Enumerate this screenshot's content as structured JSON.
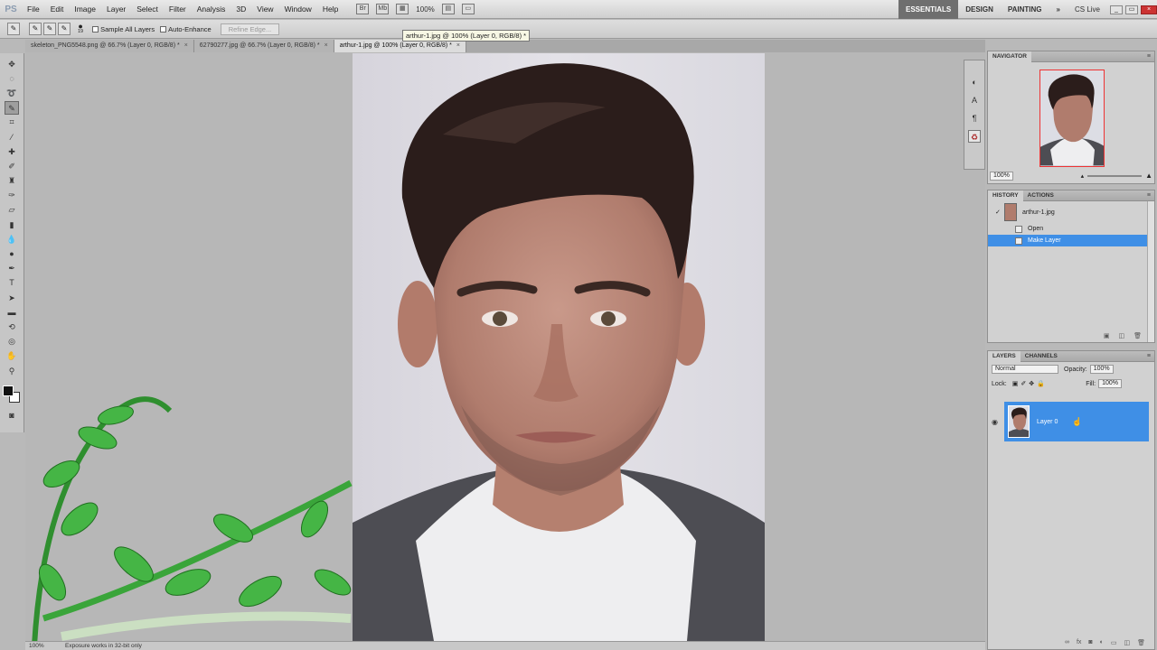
{
  "app": {
    "logo": "PS"
  },
  "menu": [
    "File",
    "Edit",
    "Image",
    "Layer",
    "Select",
    "Filter",
    "Analysis",
    "3D",
    "View",
    "Window",
    "Help"
  ],
  "zoom_combo": "100%",
  "workspaces": {
    "essentials": "ESSENTIALS",
    "design": "DESIGN",
    "painting": "PAINTING",
    "more": "»",
    "cs_live": "CS Live"
  },
  "options": {
    "brush_size": "19",
    "sample_all_layers": "Sample All Layers",
    "auto_enhance": "Auto-Enhance",
    "refine_edge": "Refine Edge..."
  },
  "tabs": [
    {
      "label": "skeleton_PNG5548.png @ 66.7% (Layer 0, RGB/8) *"
    },
    {
      "label": "62790277.jpg @ 66.7% (Layer 0, RGB/8) *"
    },
    {
      "label": "arthur-1.jpg @ 100% (Layer 0, RGB/8) *"
    }
  ],
  "tooltip": "arthur-1.jpg @ 100% (Layer 0, RGB/8) *",
  "status": {
    "zoom": "100%",
    "message": "Exposure works in 32-bit only"
  },
  "navigator": {
    "title": "NAVIGATOR",
    "zoom": "100%"
  },
  "history": {
    "tabs": [
      "HISTORY",
      "ACTIONS"
    ],
    "snapshot": "arthur-1.jpg",
    "items": [
      "Open",
      "Make Layer"
    ]
  },
  "layers": {
    "tabs": [
      "LAYERS",
      "CHANNELS"
    ],
    "blend_mode": "Normal",
    "opacity_label": "Opacity:",
    "opacity": "100%",
    "lock_label": "Lock:",
    "fill_label": "Fill:",
    "fill": "100%",
    "layer_name": "Layer 0"
  },
  "colors": {
    "selection": "#3f8fe6",
    "active_workspace": "#6f6f6f"
  }
}
